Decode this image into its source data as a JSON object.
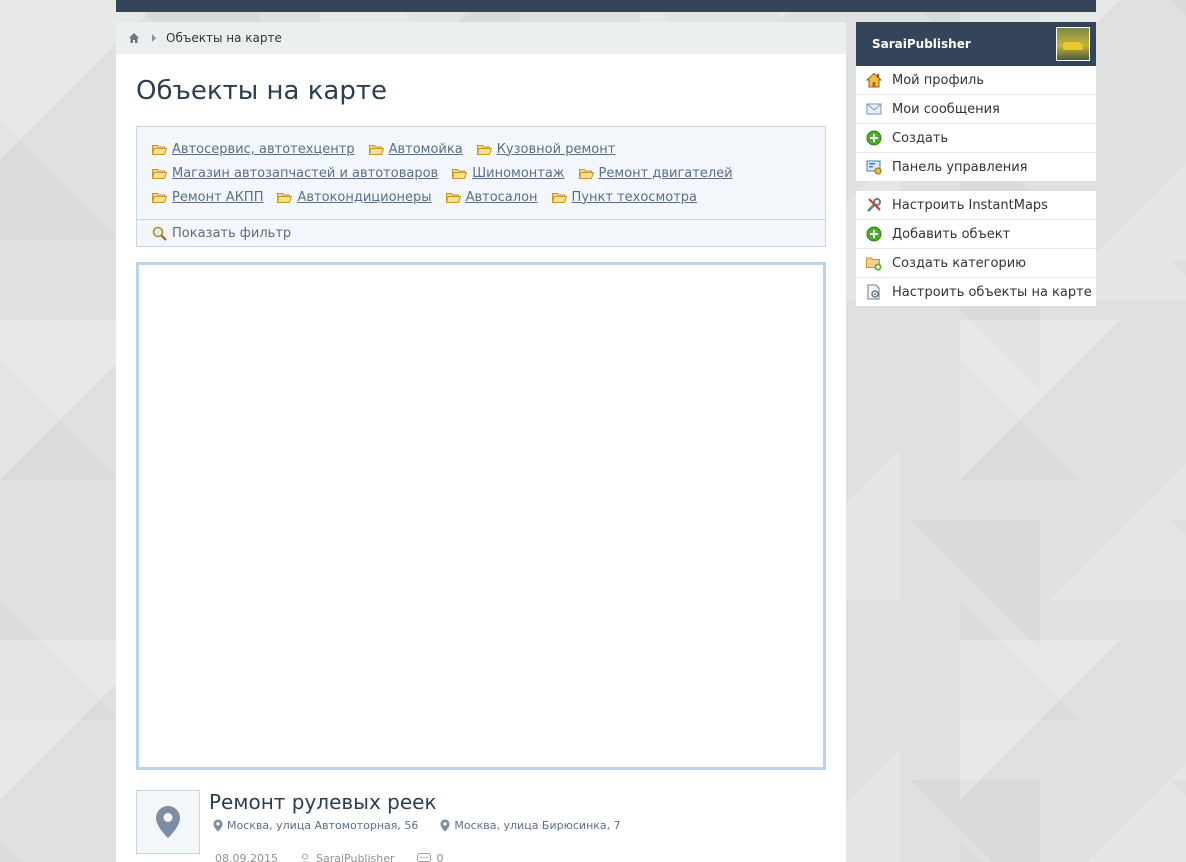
{
  "breadcrumb": {
    "current": "Объекты на карте"
  },
  "page": {
    "title": "Объекты на карте"
  },
  "categories": {
    "rows": [
      [
        "Автосервис, автотехцентр",
        "Автомойка",
        "Кузовной ремонт"
      ],
      [
        "Магазин автозапчастей и автотоваров",
        "Шиномонтаж",
        "Ремонт двигателей"
      ],
      [
        "Ремонт АКПП",
        "Автокондиционеры",
        "Автосалон",
        "Пункт техосмотра"
      ]
    ],
    "filter_label": "Показать фильтр"
  },
  "object": {
    "title": "Ремонт рулевых реек",
    "addresses": [
      "Москва, улица Автомоторная, 56",
      "Москва, улица Бирюсинка, 7"
    ],
    "date": "08.09.2015",
    "author": "SaraiPublisher",
    "comments": "0"
  },
  "user": {
    "name": "SaraiPublisher",
    "menu": [
      {
        "label": "Мой профиль",
        "icon": "house-icon"
      },
      {
        "label": "Мои сообщения",
        "icon": "envelope-icon"
      },
      {
        "label": "Создать",
        "icon": "plus-circle-icon"
      },
      {
        "label": "Панель управления",
        "icon": "control-panel-icon"
      }
    ]
  },
  "admin": {
    "menu": [
      {
        "label": "Настроить InstantMaps",
        "icon": "tools-icon"
      },
      {
        "label": "Добавить объект",
        "icon": "plus-circle-icon"
      },
      {
        "label": "Создать категорию",
        "icon": "folder-add-icon"
      },
      {
        "label": "Настроить объекты на карте",
        "icon": "settings-document-icon"
      }
    ]
  },
  "colors": {
    "header": "#34445a",
    "link": "#5a6e87",
    "map_border": "#b8d5f0",
    "category_bg": "#f3f7fb"
  }
}
